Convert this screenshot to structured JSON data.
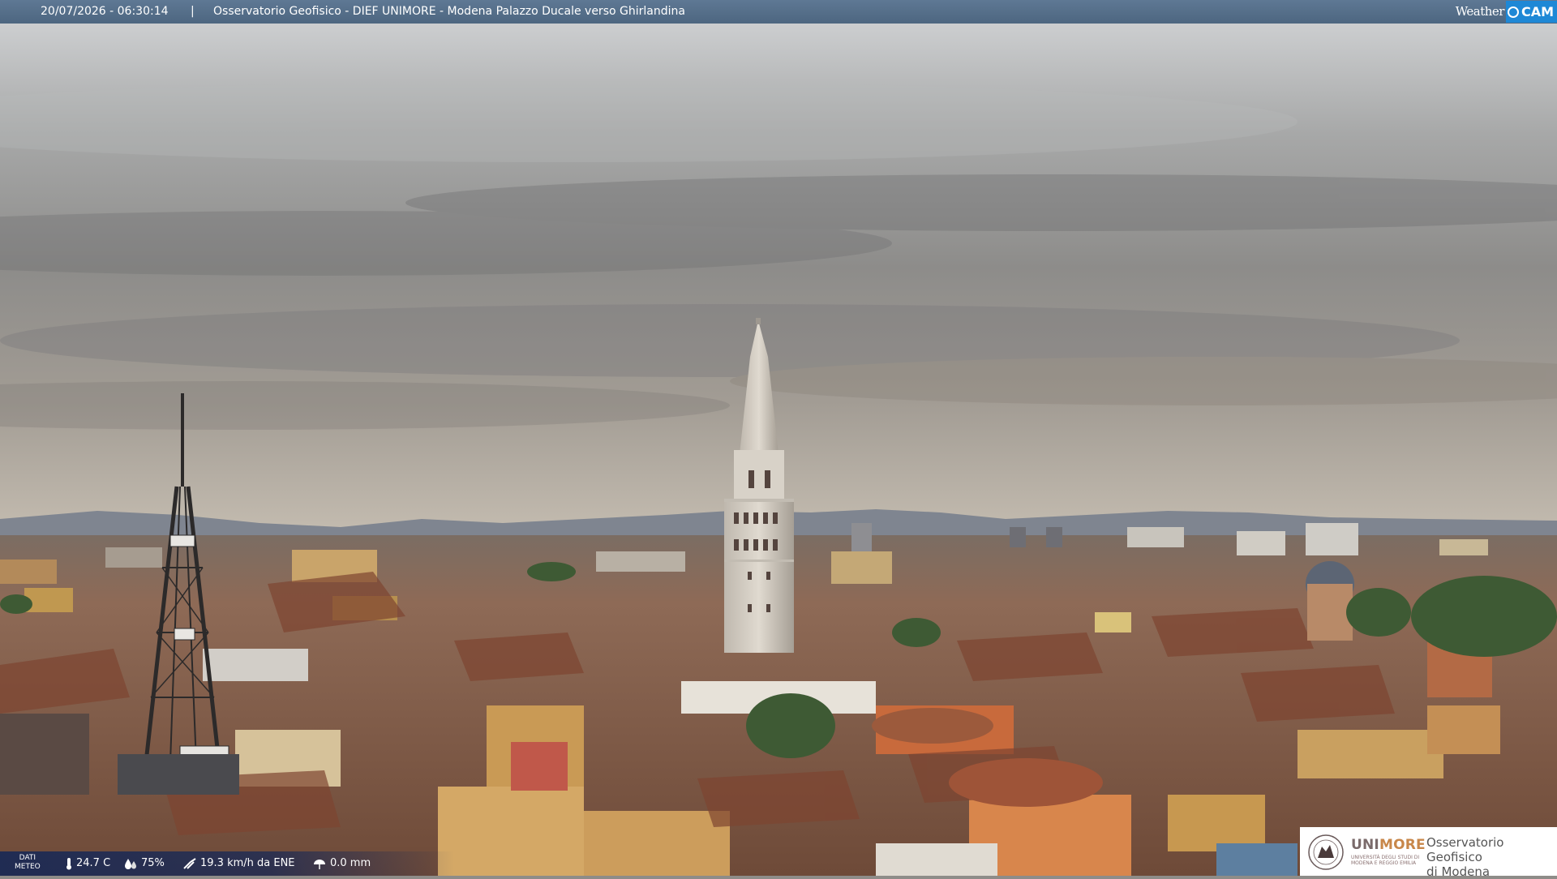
{
  "overlay": {
    "datetime": "20/07/2026 - 06:30:14",
    "separator": "|",
    "title": "Osservatorio Geofisico - DIEF UNIMORE - Modena Palazzo Ducale verso Ghirlandina",
    "brand_weather": "Weather",
    "brand_cam": "CAM"
  },
  "meteo": {
    "label_line1": "DATI",
    "label_line2": "METEO",
    "temperature": "24.7 C",
    "humidity": "75%",
    "wind": "19.3 km/h da ENE",
    "rain": "0.0 mm",
    "icons": [
      "thermometer-icon",
      "humidity-drops-icon",
      "wind-icon",
      "rain-icon"
    ]
  },
  "logo": {
    "unimore_a": "UNI",
    "unimore_b": "MORE",
    "unimore_sub_1": "UNIVERSITÀ DEGLI STUDI DI",
    "unimore_sub_2": "MODENA E REGGIO EMILIA",
    "observatory_1": "Osservatorio Geofisico",
    "observatory_2": "di Modena"
  },
  "colors": {
    "topbar": "#4f6884",
    "meteo_bar": "#0a235a",
    "brand_accent": "#1e88d6",
    "sky": "#8e8c88",
    "roof": "#8a4a32"
  }
}
